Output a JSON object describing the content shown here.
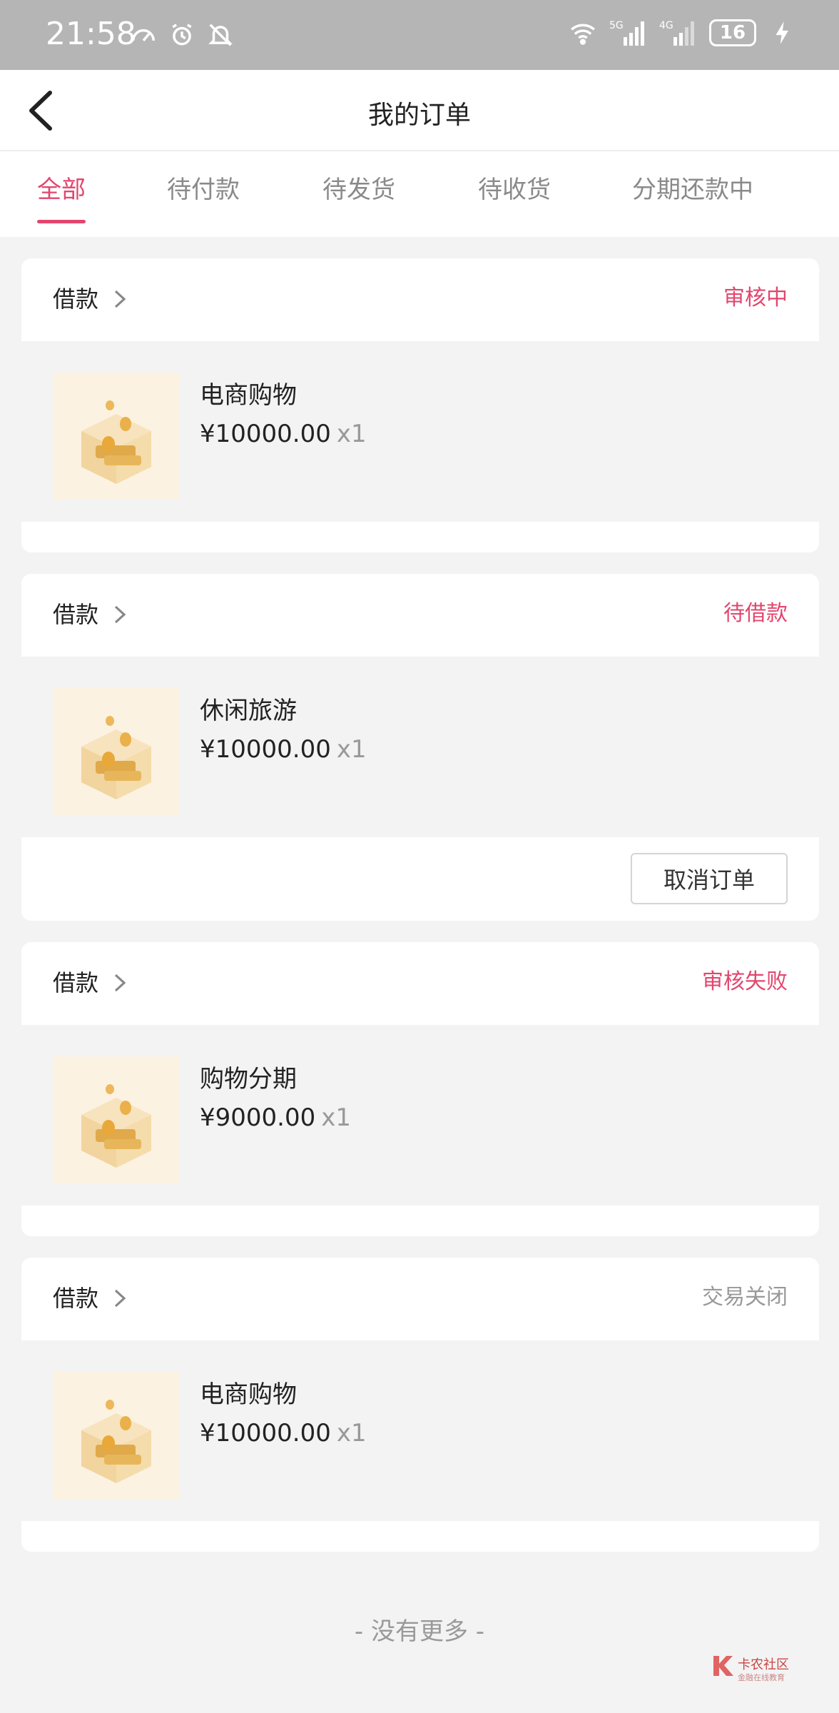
{
  "status_bar": {
    "time": "21:58",
    "battery": "16",
    "network_1": "5G",
    "network_2": "4G"
  },
  "header": {
    "title": "我的订单"
  },
  "tabs": [
    {
      "label": "全部",
      "active": true
    },
    {
      "label": "待付款",
      "active": false
    },
    {
      "label": "待发货",
      "active": false
    },
    {
      "label": "待收货",
      "active": false
    },
    {
      "label": "分期还款中",
      "active": false
    }
  ],
  "orders": [
    {
      "type": "借款",
      "status": "审核中",
      "status_color": "#e2466e",
      "product": "电商购物",
      "price": "¥10000.00",
      "qty": "x1"
    },
    {
      "type": "借款",
      "status": "待借款",
      "status_color": "#e2466e",
      "product": "休闲旅游",
      "price": "¥10000.00",
      "qty": "x1",
      "action": "取消订单"
    },
    {
      "type": "借款",
      "status": "审核失败",
      "status_color": "#e2466e",
      "product": "购物分期",
      "price": "¥9000.00",
      "qty": "x1"
    },
    {
      "type": "借款",
      "status": "交易关闭",
      "status_color": "#999999",
      "product": "电商购物",
      "price": "¥10000.00",
      "qty": "x1"
    }
  ],
  "footer": {
    "no_more": "- 没有更多 -"
  },
  "watermark": {
    "name": "卡农社区",
    "sub": "金融在线教育"
  },
  "colors": {
    "accent": "#e2466e",
    "background": "#f3f3f3",
    "status_bar": "#b5b5b5"
  }
}
